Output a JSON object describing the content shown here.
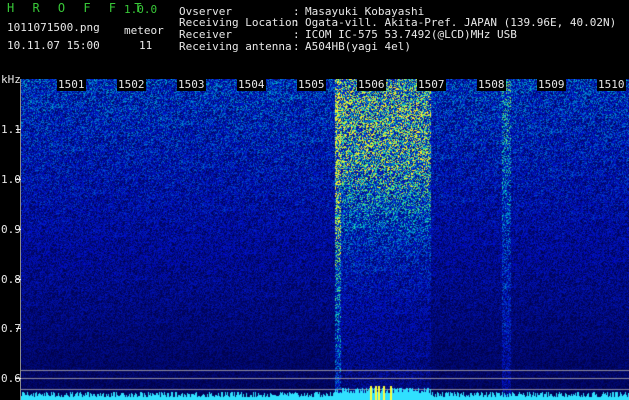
{
  "header": {
    "app_title": "H R O F F T",
    "version": "1.0.0",
    "filename": "1011071500.png",
    "datetime": "10.11.07 15:00",
    "meteor_label": "meteor",
    "meteor_count": "11"
  },
  "info": [
    {
      "label": "Ovserver",
      "value": "Masayuki Kobayashi"
    },
    {
      "label": "Receiving Location",
      "value": "Ogata-vill. Akita-Pref. JAPAN (139.96E, 40.02N)"
    },
    {
      "label": "Receiver",
      "value": "ICOM IC-575 53.7492(@LCD)MHz USB"
    },
    {
      "label": "Receiving antenna",
      "value": "A504HB(yagi 4el)"
    }
  ],
  "spectrogram": {
    "unit_label": "kHz",
    "y_labels": [
      "1.1",
      "1.0",
      "0.9",
      "0.8",
      "0.7",
      "0.6"
    ],
    "minute_labels": [
      "1501",
      "1502",
      "1503",
      "1504",
      "1505",
      "1506",
      "1507",
      "1508",
      "1509",
      "1510"
    ],
    "colors": {
      "text": "#e8e8e8",
      "title": "#38c838",
      "noise": "#1a2aa8",
      "signal": "#ffff40"
    }
  }
}
